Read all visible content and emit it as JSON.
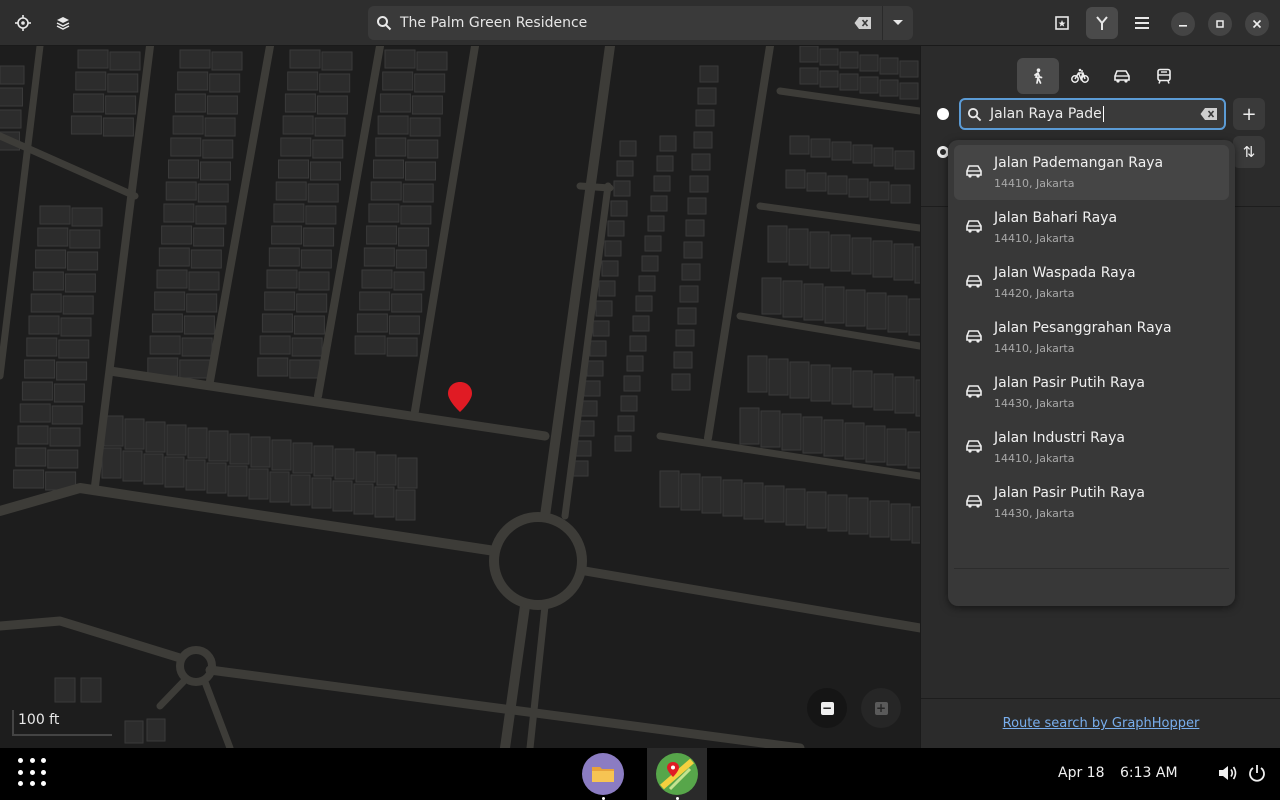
{
  "header": {
    "search_value": "The Palm Green Residence",
    "icons": [
      "locate-icon",
      "layers-icon",
      "search-icon",
      "clear-icon",
      "dropdown-icon",
      "favorites-icon",
      "route-icon",
      "menu-icon",
      "minimize-icon",
      "maximize-icon",
      "close-icon"
    ]
  },
  "map": {
    "scale_label": "100 ft",
    "zoom_out": "−",
    "zoom_in": "+"
  },
  "sidebar": {
    "transport_modes": [
      "pedestrian",
      "bicycle",
      "car",
      "transit"
    ],
    "active_mode": "pedestrian",
    "route_entry_value": "Jalan Raya Pade",
    "add_via": "+",
    "reverse": "⇅",
    "footer_link": "Route search by GraphHopper"
  },
  "suggestions": [
    {
      "name": "Jalan Pademangan Raya",
      "sub": "14410, Jakarta"
    },
    {
      "name": "Jalan Bahari Raya",
      "sub": "14410, Jakarta"
    },
    {
      "name": "Jalan Waspada Raya",
      "sub": "14420, Jakarta"
    },
    {
      "name": "Jalan Pesanggrahan Raya",
      "sub": "14410, Jakarta"
    },
    {
      "name": "Jalan Pasir Putih Raya",
      "sub": "14430, Jakarta"
    },
    {
      "name": "Jalan Industri Raya",
      "sub": "14410, Jakarta"
    },
    {
      "name": "Jalan Pasir Putih Raya",
      "sub": "14430, Jakarta"
    }
  ],
  "taskbar": {
    "date": "Apr 18",
    "time": "6:13 AM",
    "apps": [
      "files",
      "maps"
    ]
  },
  "colors": {
    "accent": "#78aeed",
    "focus": "#5b9bd5",
    "pin": "#e01b24",
    "road": "#3d3c38",
    "building": "#2c2c2c"
  }
}
